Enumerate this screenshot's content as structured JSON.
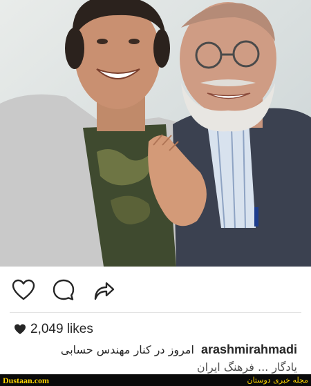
{
  "post": {
    "photo": {
      "description_icon": "selfie-photo"
    },
    "actions": {
      "like_icon": "heart-outline-icon",
      "comment_icon": "comment-bubble-icon",
      "share_icon": "share-arrow-icon"
    },
    "likes": {
      "icon": "heart-filled-icon",
      "text": "2,049 likes"
    },
    "caption": {
      "username": "arashmirahmadi",
      "line1": "امروز در کنار مهندس حسابی",
      "line2": "یادگار ... فرهنگ ایران"
    }
  },
  "watermark": {
    "left": "Dustaan.com",
    "right": "مجله خبری دوستان"
  },
  "colors": {
    "text": "#262626",
    "watermark_bg": "#0a0a0a",
    "watermark_fg": "#ffd400"
  }
}
